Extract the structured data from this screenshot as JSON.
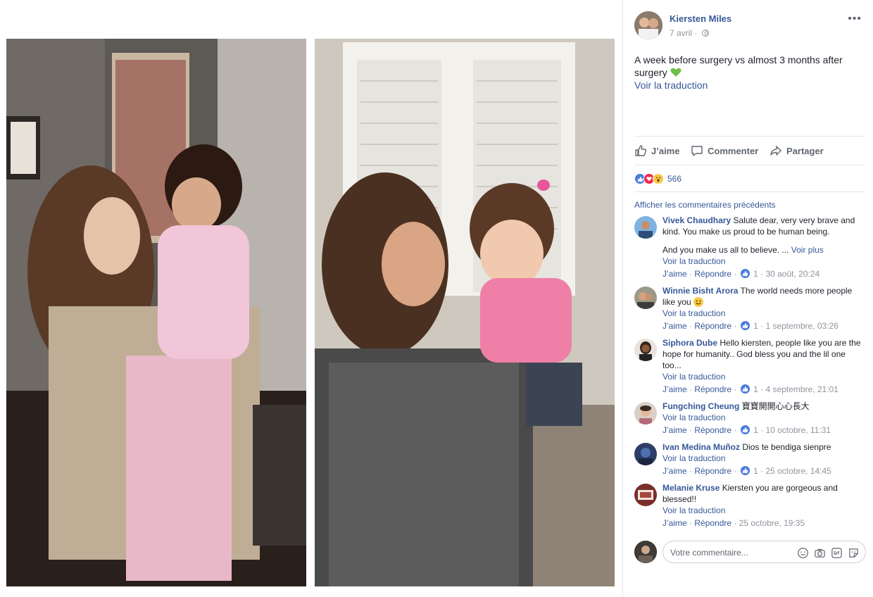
{
  "post": {
    "author": "Kiersten Miles",
    "date": "7 avril",
    "meta_separator": "·",
    "more_label": "•••",
    "text": "A week before surgery vs almost 3 months after surgery",
    "translate_label": "Voir la traduction"
  },
  "actions": {
    "like": "J’aime",
    "comment": "Commenter",
    "share": "Partager"
  },
  "reactions": {
    "count": "566",
    "types": [
      "like-icon",
      "love-icon",
      "wow-icon"
    ]
  },
  "comments_section": {
    "previous_label": "Afficher les commentaires précédents",
    "reply_label": "Répondre",
    "like_label": "J’aime",
    "translate_label": "Voir la traduction",
    "see_more_label": "Voir plus",
    "items": [
      {
        "name": "Vivek Chaudhary",
        "text": "Salute dear, very very brave and kind. You make us proud to be human being.",
        "extra": "And you make us all to believe. ...",
        "likes": "1",
        "time": "30 août, 20:24"
      },
      {
        "name": "Winnie Bisht Arora",
        "text": "The world needs more people like you",
        "likes": "1",
        "time": "1 septembre, 03:26"
      },
      {
        "name": "Siphora Dube",
        "text": "Hello kiersten, people like you are the hope for humanity.. God bless you and the lil one too...",
        "likes": "1",
        "time": "4 septembre, 21:01"
      },
      {
        "name": "Fungching Cheung",
        "text": "寶寶開開心心長大",
        "likes": "1",
        "time": "10 octobre, 11:31"
      },
      {
        "name": "Ivan Medina Muñoz",
        "text": "Dios te bendiga sienpre",
        "likes": "1",
        "time": "25 octobre, 14:45"
      },
      {
        "name": "Melanie Kruse",
        "text": "Kiersten you are gorgeous and blessed!!",
        "time": "25 octobre, 19:35"
      }
    ]
  },
  "composer": {
    "placeholder": "Votre commentaire..."
  },
  "colors": {
    "link": "#365899",
    "meta": "#90949c",
    "like_blue": "#4a7bdb",
    "love_red": "#f0284a",
    "heart_green": "#6cc04a"
  }
}
